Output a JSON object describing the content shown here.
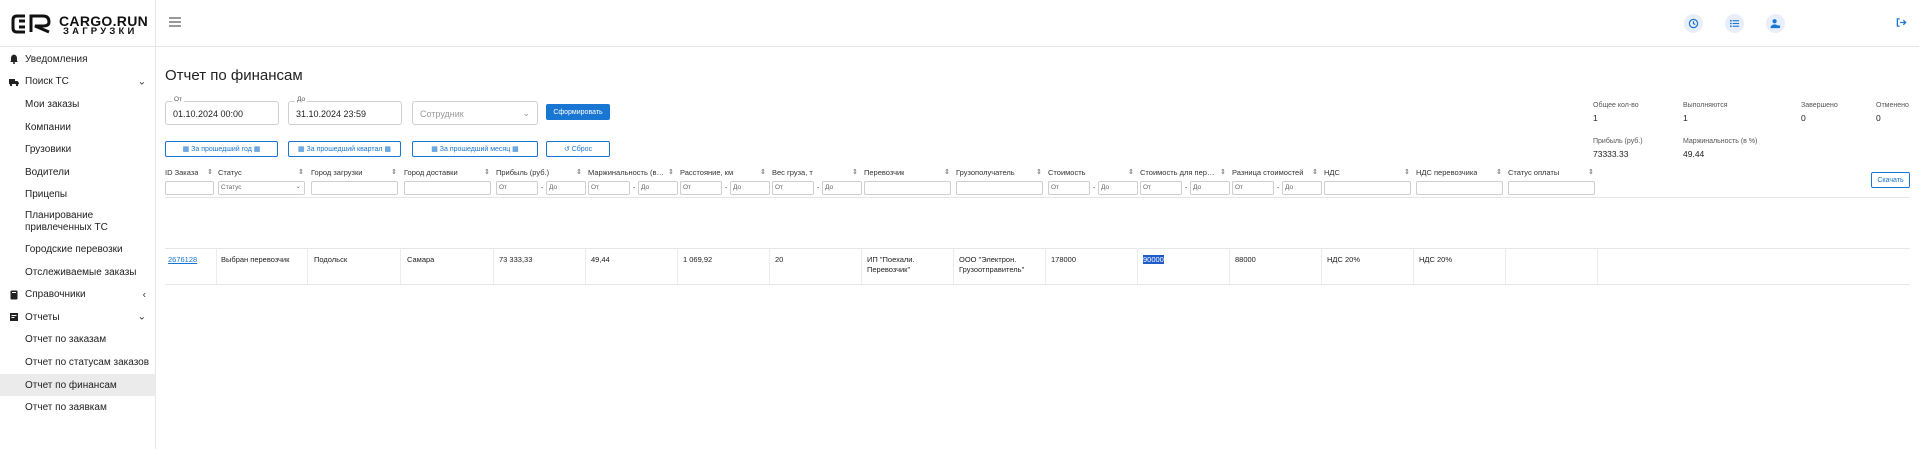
{
  "app": {
    "brand": "CARGO.RUN",
    "brand_sub": "ЗАГРУЗКИ"
  },
  "sidebar": {
    "items": [
      {
        "label": "Уведомления",
        "icon": "bell-icon",
        "level": "top"
      },
      {
        "label": "Поиск ТС",
        "icon": "truck-icon",
        "level": "top",
        "chevron": "down"
      },
      {
        "label": "Мои заказы",
        "level": "sub"
      },
      {
        "label": "Компании",
        "level": "sub"
      },
      {
        "label": "Грузовики",
        "level": "sub"
      },
      {
        "label": "Водители",
        "level": "sub"
      },
      {
        "label": "Прицепы",
        "level": "sub"
      },
      {
        "label": "Планирование привлеченных ТС",
        "level": "sub"
      },
      {
        "label": "Городские перевозки",
        "level": "sub"
      },
      {
        "label": "Отслеживаемые заказы",
        "level": "sub"
      },
      {
        "label": "Справочники",
        "icon": "book-icon",
        "level": "top",
        "chevron": "left"
      },
      {
        "label": "Отчеты",
        "icon": "report-icon",
        "level": "top",
        "chevron": "down"
      },
      {
        "label": "Отчет по заказам",
        "level": "sub"
      },
      {
        "label": "Отчет по статусам заказов",
        "level": "sub"
      },
      {
        "label": "Отчет по финансам",
        "level": "sub",
        "active": true
      },
      {
        "label": "Отчет по заявкам",
        "level": "sub"
      }
    ]
  },
  "topbar": {
    "icons": [
      "history-icon",
      "list-icon",
      "user-settings-icon"
    ],
    "logout_icon": "logout-icon"
  },
  "page": {
    "title": "Отчет по финансам"
  },
  "filters": {
    "from_label": "От",
    "from_value": "01.10.2024 00:00",
    "to_label": "До",
    "to_value": "31.10.2024 23:59",
    "employee_placeholder": "Сотрудник",
    "generate_button": "Сформировать",
    "last_year": "За прошедший год",
    "last_quarter": "За прошедший квартал",
    "last_month": "За прошедший месяц",
    "reset": "Сброс"
  },
  "stats": {
    "total_label": "Общее кол-во",
    "total_value": "1",
    "in_progress_label": "Выполняются",
    "in_progress_value": "1",
    "completed_label": "Завершено",
    "completed_value": "0",
    "cancelled_label": "Отменено",
    "cancelled_value": "0",
    "profit_label": "Прибыль (руб.)",
    "profit_value": "73333.33",
    "margin_label": "Маржинальность (в %)",
    "margin_value": "49.44"
  },
  "download_button": "Скачать",
  "table": {
    "columns": [
      "ID Заказа",
      "Статус",
      "Город загрузки",
      "Город доставки",
      "Прибыль (руб.)",
      "Маржинальность (в %)",
      "Расстояние, км",
      "Вес груза, т",
      "Перевозчик",
      "Грузополучатель",
      "Стоимость",
      "Стоимость для перевозчика",
      "Разница стоимостей",
      "НДС",
      "НДС перевозчика",
      "Статус оплаты"
    ],
    "filter_status_placeholder": "Статус",
    "range_from": "От",
    "range_to": "До",
    "rows": [
      {
        "id": "2676128",
        "status": "Выбран перевозчик",
        "load_city": "Подольск",
        "delivery_city": "Самара",
        "profit": "73 333,33",
        "margin": "49,44",
        "distance": "1 069,92",
        "weight": "20",
        "carrier": "ИП \"Поехали. Перевозчик\"",
        "consignee_line1": "ООО \"Электрон.",
        "consignee_line2": "Грузоотправитель\"",
        "cost": "178000",
        "carrier_cost": "90000",
        "cost_diff": "88000",
        "vat": "НДС 20%",
        "carrier_vat": "НДС 20%",
        "payment_status": ""
      }
    ]
  }
}
